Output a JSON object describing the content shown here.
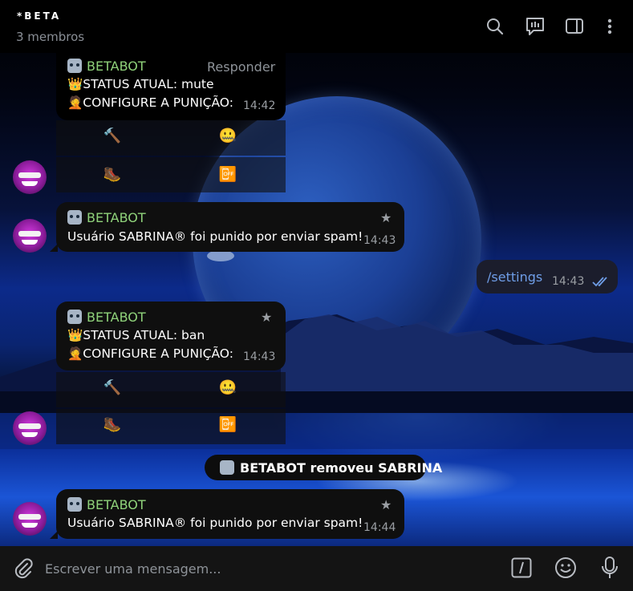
{
  "header": {
    "title": "*BETA",
    "subtitle": "3 membros",
    "icons": [
      "search-icon",
      "poll-icon",
      "sidebar-toggle-icon",
      "more-vert-icon"
    ]
  },
  "messages": [
    {
      "id": "m1",
      "sender": "BETABOT",
      "reply_label": "Responder",
      "status_line": "👑STATUS ATUAL: mute",
      "config_line": "🤦CONFIGURE A PUNIÇÃO:",
      "time": "14:42",
      "keyboard": [
        "🔨",
        "🤐",
        "🥾",
        "📴"
      ]
    },
    {
      "id": "m2",
      "sender": "BETABOT",
      "text": "Usuário SABRINA® foi punido por enviar spam!",
      "time": "14:43",
      "star": "★"
    },
    {
      "id": "m3",
      "outgoing": true,
      "text": "/settings",
      "time": "14:43",
      "read_icon": "double-check-icon"
    },
    {
      "id": "m4",
      "sender": "BETABOT",
      "status_line": "👑STATUS ATUAL: ban",
      "config_line": "🤦CONFIGURE A PUNIÇÃO:",
      "time": "14:43",
      "star": "★",
      "keyboard": [
        "🔨",
        "🤐",
        "🥾",
        "📴"
      ]
    },
    {
      "id": "m5",
      "service": true,
      "text": "BETABOT removeu SABRINA"
    },
    {
      "id": "m6",
      "sender": "BETABOT",
      "text": "Usuário SABRINA® foi punido por enviar spam!",
      "time": "14:44",
      "star": "★"
    }
  ],
  "composer": {
    "placeholder": "Escrever uma mensagem...",
    "icons": [
      "attach-icon",
      "commands-icon",
      "emoji-icon",
      "mic-icon"
    ]
  },
  "colors": {
    "sender": "#8fd27a",
    "bubble": "#0f0f0f",
    "outgoing_bubble": "#1b1d2c",
    "link": "#6f9ee8",
    "read_check": "#6f9ee8"
  }
}
